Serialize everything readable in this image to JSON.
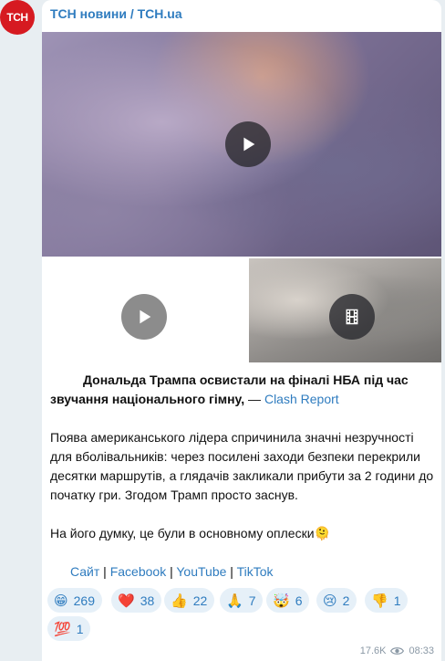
{
  "channel": {
    "avatar_text": "ТСН",
    "name": "ТСН новини / TCH.ua"
  },
  "post": {
    "headline_bold": "Дональда Трампа освистали на фіналі НБА під час звучання національного гімну,",
    "headline_dash": " — ",
    "source_link": "Clash Report",
    "paragraph1": "Поява американського лідера спричинила значні незручності для вболівальників: через посилені заходи безпеки перекрили десятки маршрутів, а глядачів закликали прибути за 2 години до початку гри. Згодом Трамп просто заснув.",
    "paragraph2": "На його думку, це були в основному оплески🫠",
    "links": [
      "Сайт",
      "Facebook",
      "YouTube",
      "TikTok"
    ],
    "link_separator": " | "
  },
  "reactions": [
    {
      "emoji": "😁",
      "count": "269"
    },
    {
      "emoji": "❤️",
      "count": "38"
    },
    {
      "emoji": "👍",
      "count": "22"
    },
    {
      "emoji": "🙏",
      "count": "7"
    },
    {
      "emoji": "🤯",
      "count": "6"
    },
    {
      "emoji": "😢",
      "count": "2"
    },
    {
      "emoji": "👎",
      "count": "1"
    },
    {
      "emoji": "💯",
      "count": "1"
    }
  ],
  "footer": {
    "views": "17.6K",
    "time": "08:33"
  },
  "icons": {
    "play": "play-icon",
    "video": "video-icon",
    "views": "eye-icon"
  }
}
